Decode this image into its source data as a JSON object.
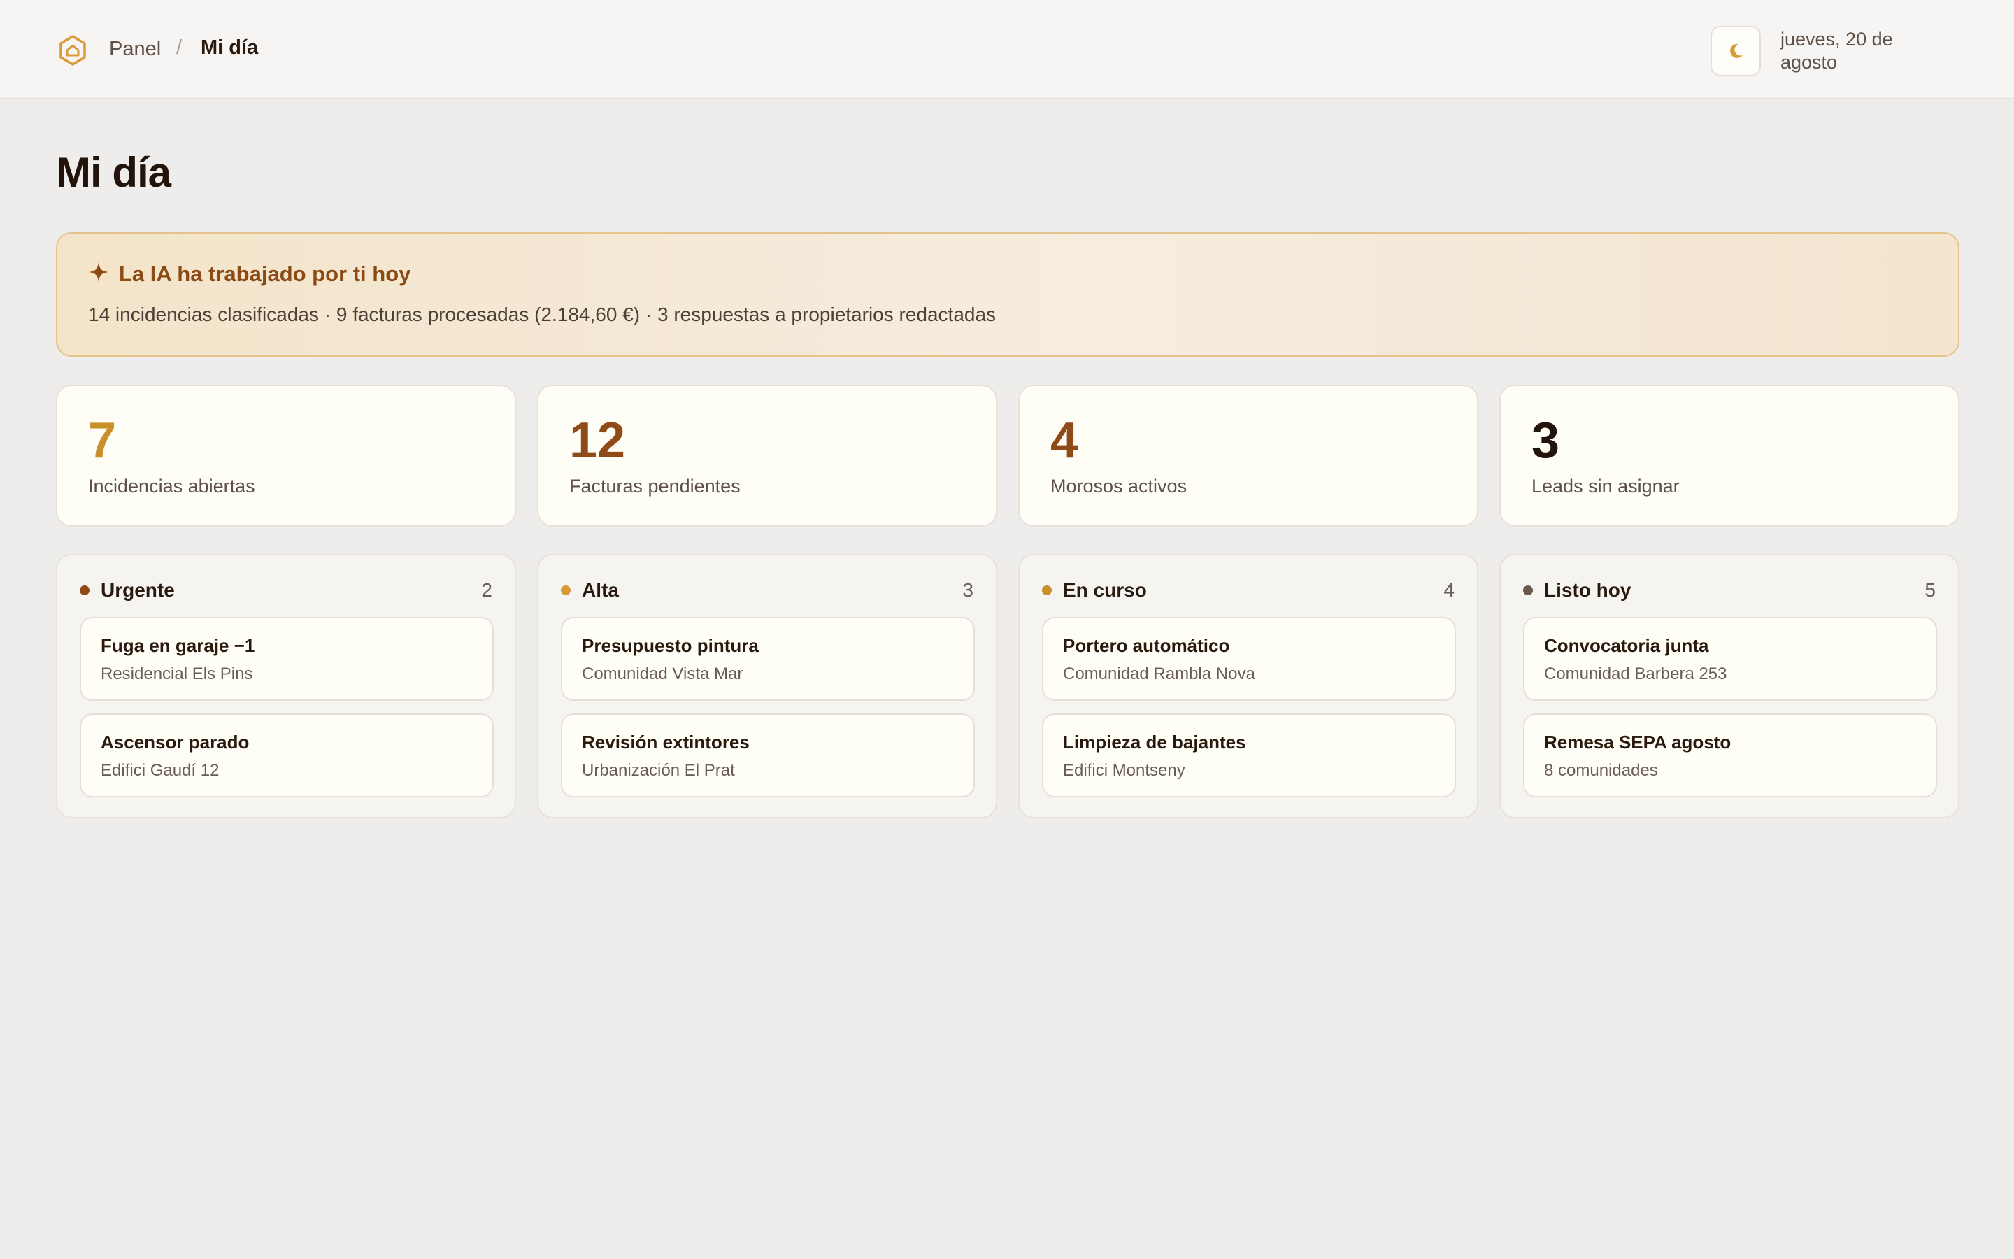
{
  "breadcrumb": {
    "root": "Panel",
    "separator": "/",
    "current": "Mi día"
  },
  "header": {
    "date": "jueves, 20 de agosto"
  },
  "page": {
    "title": "Mi día"
  },
  "ai_banner": {
    "title": "La IA ha trabajado por ti hoy",
    "summary": "14 incidencias clasificadas · 9 facturas procesadas (2.184,60 €) · 3 respuestas a propietarios redactadas"
  },
  "stats": [
    {
      "value": "7",
      "label": "Incidencias abiertas",
      "color": "#c98f2a"
    },
    {
      "value": "12",
      "label": "Facturas pendientes",
      "color": "#8f4a17"
    },
    {
      "value": "4",
      "label": "Morosos activos",
      "color": "#8f4a17"
    },
    {
      "value": "3",
      "label": "Leads sin asignar",
      "color": "#22140a"
    }
  ],
  "columns": [
    {
      "title": "Urgente",
      "count": "2",
      "dot_color": "#8f4a17",
      "tasks": [
        {
          "title": "Fuga en garaje −1",
          "subtitle": "Residencial Els Pins"
        },
        {
          "title": "Ascensor parado",
          "subtitle": "Edifici Gaudí 12"
        }
      ]
    },
    {
      "title": "Alta",
      "count": "3",
      "dot_color": "#d99a3a",
      "tasks": [
        {
          "title": "Presupuesto pintura",
          "subtitle": "Comunidad Vista Mar"
        },
        {
          "title": "Revisión extintores",
          "subtitle": "Urbanización El Prat"
        }
      ]
    },
    {
      "title": "En curso",
      "count": "4",
      "dot_color": "#c98f2a",
      "tasks": [
        {
          "title": "Portero automático",
          "subtitle": "Comunidad Rambla Nova"
        },
        {
          "title": "Limpieza de bajantes",
          "subtitle": "Edifici Montseny"
        }
      ]
    },
    {
      "title": "Listo hoy",
      "count": "5",
      "dot_color": "#6b5a4c",
      "tasks": [
        {
          "title": "Convocatoria junta",
          "subtitle": "Comunidad Barbera 253"
        },
        {
          "title": "Remesa SEPA agosto",
          "subtitle": "8 comunidades"
        }
      ]
    }
  ],
  "icons": {
    "logo": "home-hexagon-icon",
    "theme": "moon-icon",
    "ai": "sparkle-icon"
  },
  "colors": {
    "accent": "#c98f2a",
    "brand_brown": "#8b4a16"
  }
}
